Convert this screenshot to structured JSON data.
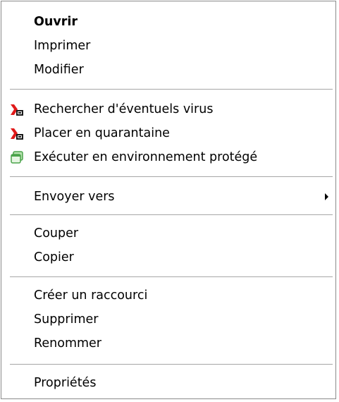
{
  "menu": {
    "items": [
      {
        "label": "Ouvrir",
        "icon": null,
        "bold": true
      },
      {
        "label": "Imprimer",
        "icon": null
      },
      {
        "label": "Modifier",
        "icon": null
      },
      {
        "label": "Rechercher d'éventuels virus",
        "icon": "kaspersky-scan-icon"
      },
      {
        "label": "Placer en quarantaine",
        "icon": "kaspersky-quarantine-icon"
      },
      {
        "label": "Exécuter en environnement protégé",
        "icon": "sandbox-window-icon"
      },
      {
        "label": "Envoyer vers",
        "icon": null,
        "submenu": true
      },
      {
        "label": "Couper",
        "icon": null
      },
      {
        "label": "Copier",
        "icon": null
      },
      {
        "label": "Créer un raccourci",
        "icon": null
      },
      {
        "label": "Supprimer",
        "icon": null
      },
      {
        "label": "Renommer",
        "icon": null
      },
      {
        "label": "Propriétés",
        "icon": null
      }
    ]
  },
  "colors": {
    "text": "#000000",
    "separator": "#a6a6a6",
    "border": "#8a8a8a",
    "kaspersky_red": "#e01a1a",
    "sandbox_green": "#4aa34a"
  }
}
